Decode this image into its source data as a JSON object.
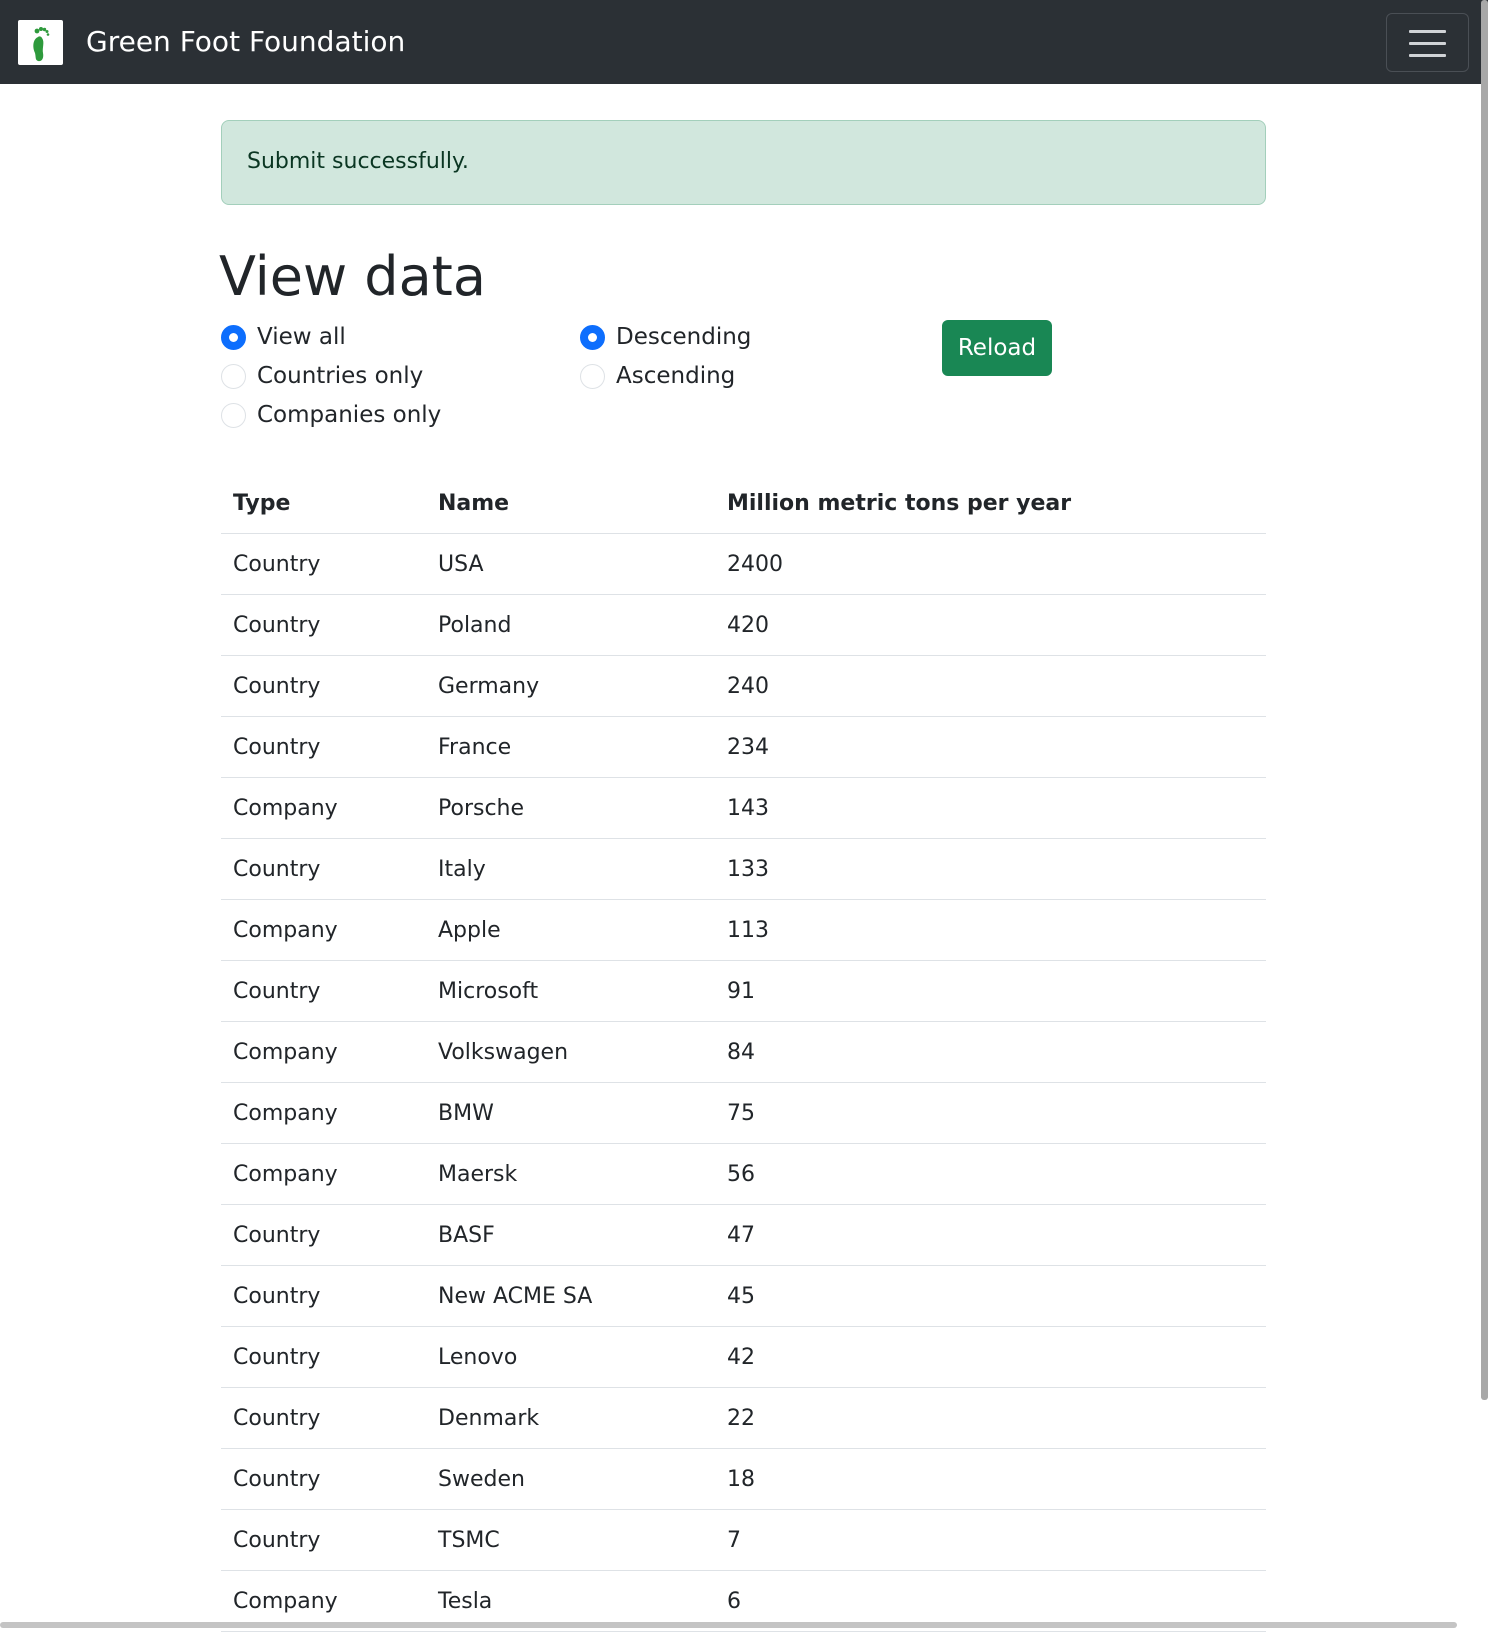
{
  "navbar": {
    "brand_name": "Green Foot Foundation",
    "logo_icon": "green-footprint-icon",
    "menu_icon": "hamburger-menu-icon"
  },
  "alert": {
    "message": "Submit successfully."
  },
  "page": {
    "title": "View data"
  },
  "filters": {
    "options": [
      {
        "label": "View all",
        "checked": true
      },
      {
        "label": "Countries only",
        "checked": false
      },
      {
        "label": "Companies only",
        "checked": false
      }
    ]
  },
  "sort": {
    "options": [
      {
        "label": "Descending",
        "checked": true
      },
      {
        "label": "Ascending",
        "checked": false
      }
    ]
  },
  "actions": {
    "reload_label": "Reload"
  },
  "table": {
    "headers": [
      "Type",
      "Name",
      "Million metric tons per year"
    ],
    "rows": [
      [
        "Country",
        "USA",
        "2400"
      ],
      [
        "Country",
        "Poland",
        "420"
      ],
      [
        "Country",
        "Germany",
        "240"
      ],
      [
        "Country",
        "France",
        "234"
      ],
      [
        "Company",
        "Porsche",
        "143"
      ],
      [
        "Country",
        "Italy",
        "133"
      ],
      [
        "Company",
        "Apple",
        "113"
      ],
      [
        "Country",
        "Microsoft",
        "91"
      ],
      [
        "Company",
        "Volkswagen",
        "84"
      ],
      [
        "Company",
        "BMW",
        "75"
      ],
      [
        "Company",
        "Maersk",
        "56"
      ],
      [
        "Country",
        "BASF",
        "47"
      ],
      [
        "Country",
        "New ACME SA",
        "45"
      ],
      [
        "Country",
        "Lenovo",
        "42"
      ],
      [
        "Country",
        "Denmark",
        "22"
      ],
      [
        "Country",
        "Sweden",
        "18"
      ],
      [
        "Country",
        "TSMC",
        "7"
      ],
      [
        "Company",
        "Tesla",
        "6"
      ]
    ]
  },
  "colors": {
    "navbar_bg": "#2b3035",
    "alert_bg": "#d1e7dd",
    "radio_checked": "#0d6efd",
    "reload_button": "#198754",
    "logo_foot": "#2e9a3c"
  }
}
